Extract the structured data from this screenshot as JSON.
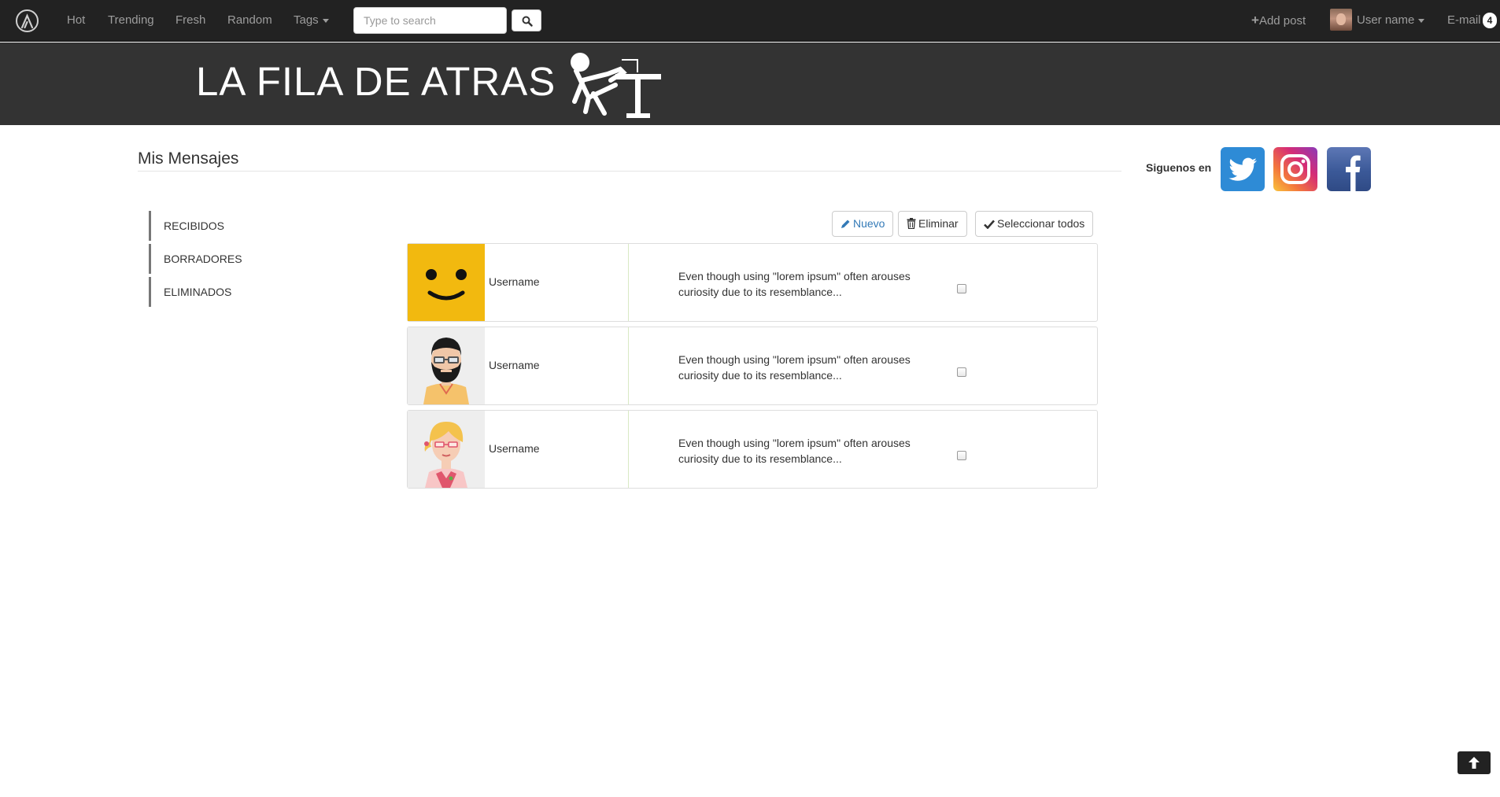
{
  "navbar": {
    "logo_icon": "lambda-logo-icon",
    "links": [
      "Hot",
      "Trending",
      "Fresh",
      "Random"
    ],
    "tags_label": "Tags",
    "search": {
      "placeholder": "Type to search",
      "value": ""
    },
    "search_icon": "search-icon",
    "add_post_label": "Add post",
    "user_name_label": "User name",
    "email_label": "E-mail",
    "email_count": "4"
  },
  "banner": {
    "title": "LA FILA DE ATRAS"
  },
  "page": {
    "title": "Mis Mensajes"
  },
  "sidebar": {
    "items": [
      {
        "label": "RECIBIDOS"
      },
      {
        "label": "BORRADORES"
      },
      {
        "label": "ELIMINADOS"
      }
    ]
  },
  "social": {
    "label": "Siguenos en",
    "networks": [
      "twitter-icon",
      "instagram-icon",
      "facebook-icon"
    ]
  },
  "toolbar": {
    "new_label": "Nuevo",
    "delete_label": "Eliminar",
    "select_all_label": "Seleccionar todos"
  },
  "messages": [
    {
      "username": "Username",
      "preview": "Even though using \"lorem ipsum\" often arouses curiosity due to its resemblance...",
      "avatar": "smiley-avatar",
      "checked": false
    },
    {
      "username": "Username",
      "preview": "Even though using \"lorem ipsum\" often arouses curiosity due to its resemblance...",
      "avatar": "bearded-man-avatar",
      "checked": false
    },
    {
      "username": "Username",
      "preview": "Even though using \"lorem ipsum\" often arouses curiosity due to its resemblance...",
      "avatar": "blonde-woman-avatar",
      "checked": false
    }
  ],
  "colors": {
    "navbar_bg": "#222222",
    "banner_bg": "#333333",
    "link_primary": "#337ab7",
    "smiley_bg": "#f2b90f"
  }
}
